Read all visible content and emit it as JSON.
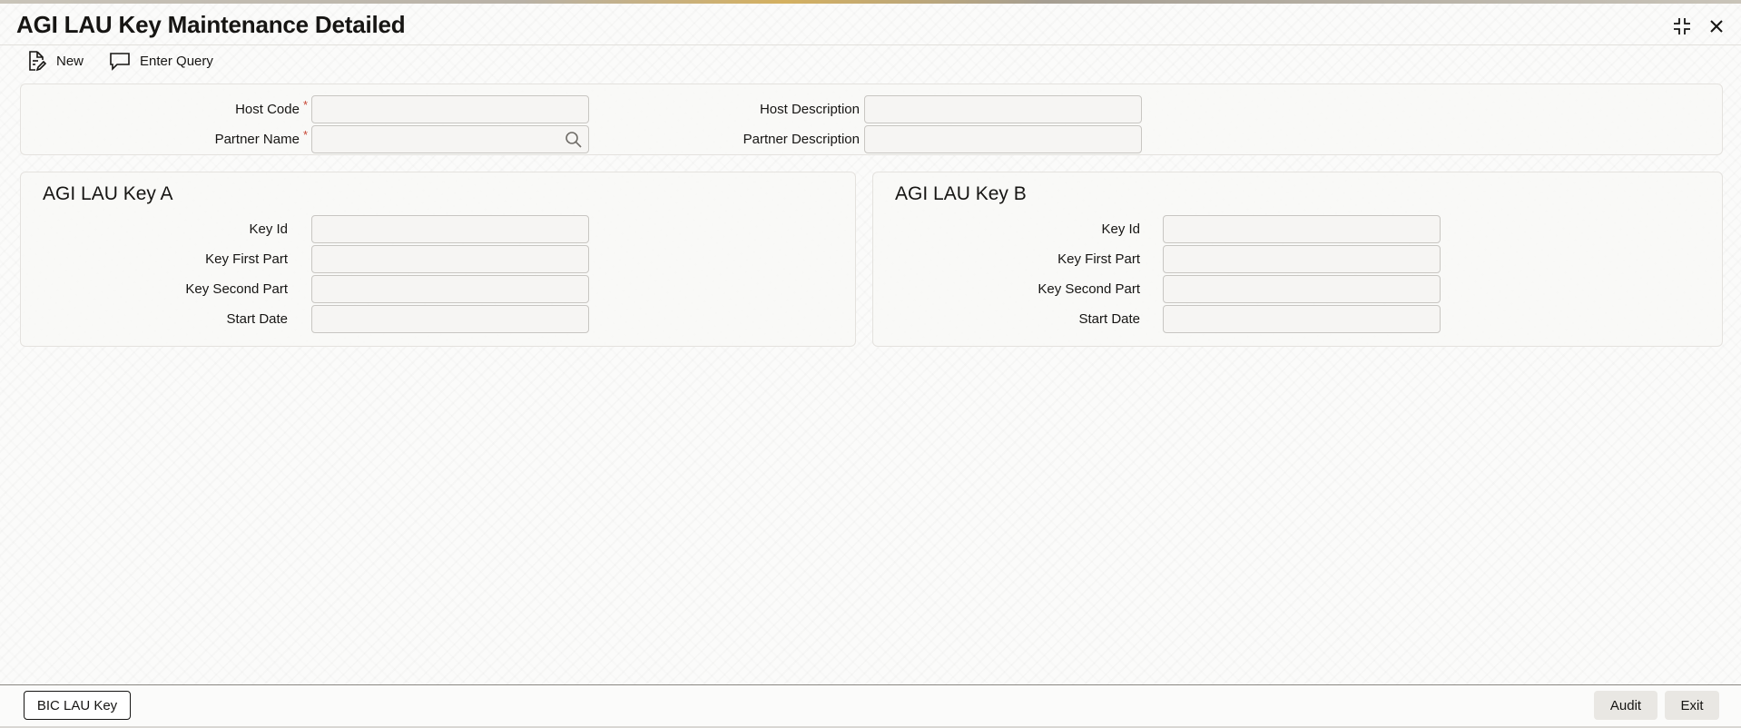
{
  "header": {
    "title": "AGI LAU Key Maintenance Detailed"
  },
  "toolbar": {
    "new_label": "New",
    "enter_query_label": "Enter Query"
  },
  "main": {
    "host_code": {
      "label": "Host Code",
      "required": "*",
      "value": ""
    },
    "host_description": {
      "label": "Host Description",
      "value": ""
    },
    "partner_name": {
      "label": "Partner Name",
      "required": "*",
      "value": ""
    },
    "partner_description": {
      "label": "Partner Description",
      "value": ""
    }
  },
  "key_a": {
    "title": "AGI LAU Key A",
    "key_id": {
      "label": "Key Id",
      "value": ""
    },
    "key_first_part": {
      "label": "Key First Part",
      "value": ""
    },
    "key_second_part": {
      "label": "Key Second Part",
      "value": ""
    },
    "start_date": {
      "label": "Start Date",
      "value": ""
    }
  },
  "key_b": {
    "title": "AGI LAU Key B",
    "key_id": {
      "label": "Key Id",
      "value": ""
    },
    "key_first_part": {
      "label": "Key First Part",
      "value": ""
    },
    "key_second_part": {
      "label": "Key Second Part",
      "value": ""
    },
    "start_date": {
      "label": "Start Date",
      "value": ""
    }
  },
  "footer": {
    "bic_lau_key_label": "BIC LAU Key",
    "audit_label": "Audit",
    "exit_label": "Exit"
  },
  "icons": {
    "new": "document-edit-icon",
    "enter_query": "chat-bubble-icon",
    "search": "search-icon",
    "minimize": "collapse-icon",
    "close": "close-icon"
  },
  "colors": {
    "required": "#c74634",
    "text": "#161513",
    "panel_border": "#e4e2de"
  }
}
